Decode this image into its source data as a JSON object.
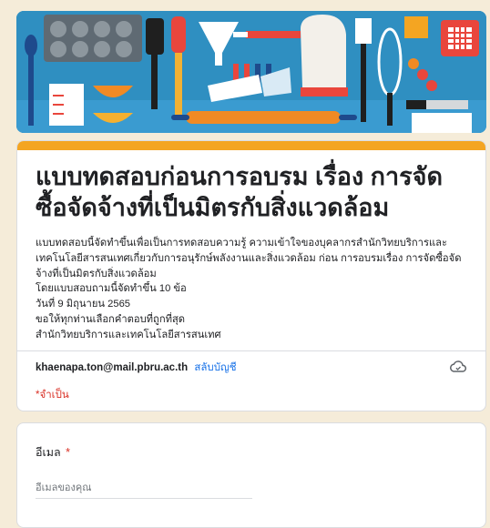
{
  "form": {
    "title": "แบบทดสอบก่อนการอบรม เรื่อง การจัดซื้อจัดจ้างที่เป็นมิตรกับสิ่งแวดล้อม",
    "description_lines": [
      "แบบทดสอบนี้จัดทำขึ้นเพื่อเป็นการทดสอบความรู้ ความเข้าใจของบุคลากรสำนักวิทยบริการและ",
      "เทคโนโลยีสารสนเทศเกี่ยวกับการอนุรักษ์พลังงานและสิ่งแวดล้อม ก่อน การอบรมเรื่อง การจัดซื้อจัด",
      "จ้างที่เป็นมิตรกับสิ่งแวดล้อม",
      "โดยแบบสอบถามนี้จัดทำขึ้น 10 ข้อ",
      "วันที่ 9 มิถุนายน 2565",
      "ขอให้ทุกท่านเลือกคำตอบที่ถูกที่สุด",
      "สำนักวิทยบริการและเทคโนโลยีสารสนเทศ"
    ],
    "account_email": "khaenapa.ton@mail.pbru.ac.th",
    "switch_account": "สลับบัญชี",
    "required_note": "*จำเป็น",
    "cloud_icon": "cloud-save-icon"
  },
  "question_email": {
    "label": "อีเมล",
    "required_mark": "*",
    "placeholder": "อีเมลของคุณ"
  },
  "colors": {
    "banner_bg": "#2f8fc1",
    "accent": "#f4a522",
    "required": "#d93025",
    "link": "#1a73e8",
    "page_bg": "#f5ecd9"
  },
  "banner": {
    "icon": "kitchen-utensils-banner"
  }
}
